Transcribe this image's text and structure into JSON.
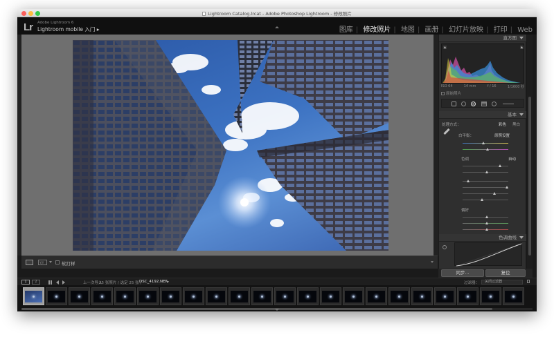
{
  "window": {
    "title": "Lightroom Catalog.lrcat - Adobe Photoshop Lightroom - 修改照片"
  },
  "identity_plate": {
    "logo": "Lr",
    "product": "Adobe Lightroom 6",
    "mobile": "Lightroom mobile 入门",
    "mobile_arrow": "▸"
  },
  "modules": [
    {
      "label": "图库",
      "active": false
    },
    {
      "label": "修改照片",
      "active": true
    },
    {
      "label": "地图",
      "active": false
    },
    {
      "label": "画册",
      "active": false
    },
    {
      "label": "幻灯片放映",
      "active": false
    },
    {
      "label": "打印",
      "active": false
    },
    {
      "label": "Web",
      "active": false
    }
  ],
  "toolbar": {
    "softproof_label": "软打样"
  },
  "right_panel": {
    "histogram": {
      "header": "直方图",
      "info": [
        "ISO 64",
        "14 mm",
        "f / 16",
        "1/1600 秒"
      ],
      "original_photo": "原始照片"
    },
    "basic": {
      "header": "基本",
      "treatment_label": "处理方式：",
      "treatment_color": "彩色",
      "treatment_bw": "黑白",
      "profile_label": "白平衡：",
      "profile_value": "原照设置",
      "tone_header": "色调",
      "tone_auto": "自动",
      "presence_header": "偏好"
    },
    "tone_curve": {
      "header": "色调曲线"
    },
    "buttons": {
      "sync": "同步...",
      "reset": "复位"
    }
  },
  "filmstrip_bar": {
    "page1": "1",
    "page2": "2",
    "path": "上一次导入",
    "count": "25 张照片 / 选定 25 张 /",
    "filename": "DSC_4192.NEF",
    "filter_label": "过滤器：",
    "filter_value": "关闭过滤器"
  }
}
